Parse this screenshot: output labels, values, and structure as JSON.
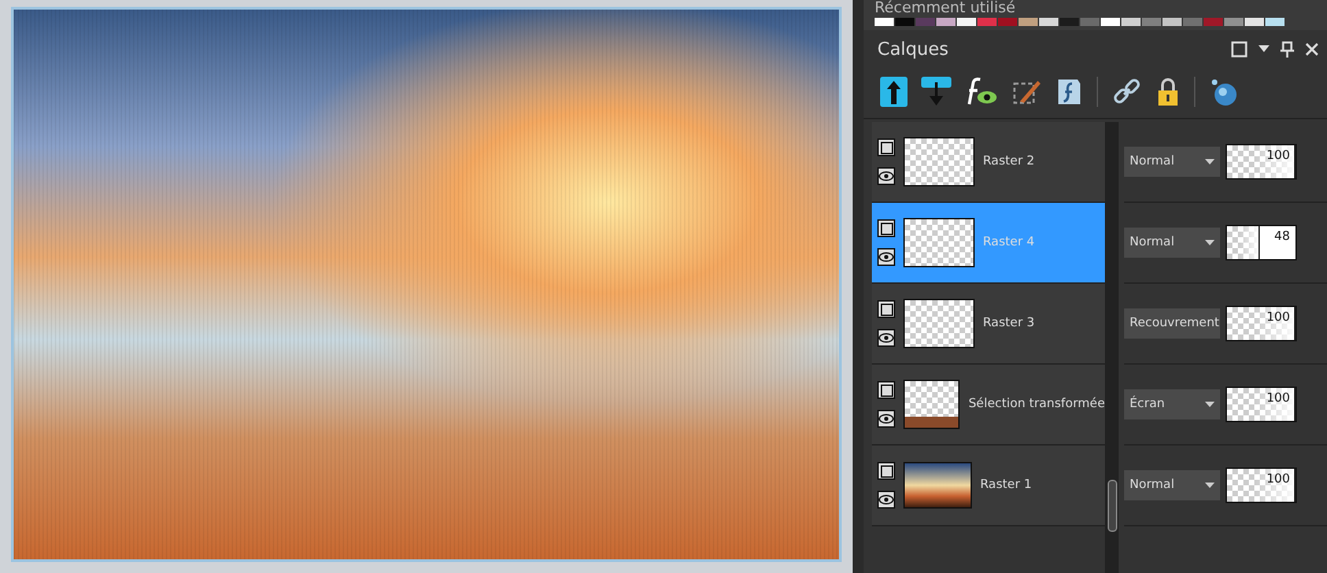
{
  "recent": {
    "title": "Récemment utilisé",
    "swatches": [
      {
        "color": "#ffffff"
      },
      {
        "color": "#0a0a0a"
      },
      {
        "color": "#5a3a5e"
      },
      {
        "color": "#c8a8c4"
      },
      {
        "color": "#f4f4f4"
      },
      {
        "color": "#e0304a"
      },
      {
        "color": "#a01020"
      },
      {
        "color": "#c0a080"
      },
      {
        "color": "#d8d8d8"
      },
      {
        "color": "#1c1c1c"
      },
      {
        "color": "#6a6a6a"
      },
      {
        "color": "#ffffff"
      },
      {
        "color": "#d0d0d0"
      },
      {
        "color": "#808080"
      },
      {
        "color": "#c4c4c4"
      },
      {
        "color": "#707070"
      },
      {
        "color": "#a01828"
      },
      {
        "color": "#909090"
      },
      {
        "color": "#e4e4e4"
      },
      {
        "color": "#b8e0f0"
      }
    ]
  },
  "panel": {
    "title": "Calques"
  },
  "layers": [
    {
      "name": "Raster 2",
      "selected": false,
      "kind": "checker",
      "blend": "Normal",
      "level": 1.0,
      "opacity": "100"
    },
    {
      "name": "Raster 4",
      "selected": true,
      "kind": "checker",
      "blend": "Normal",
      "level": 0.48,
      "opacity": "48"
    },
    {
      "name": "Raster 3",
      "selected": false,
      "kind": "checker",
      "blend": "Recouvrement",
      "level": 1.0,
      "opacity": "100"
    },
    {
      "name": "Sélection transformée",
      "selected": false,
      "kind": "partial",
      "blend": "Écran",
      "level": 1.0,
      "opacity": "100"
    },
    {
      "name": "Raster 1",
      "selected": false,
      "kind": "photo",
      "blend": "Normal",
      "level": 1.0,
      "opacity": "100"
    }
  ]
}
